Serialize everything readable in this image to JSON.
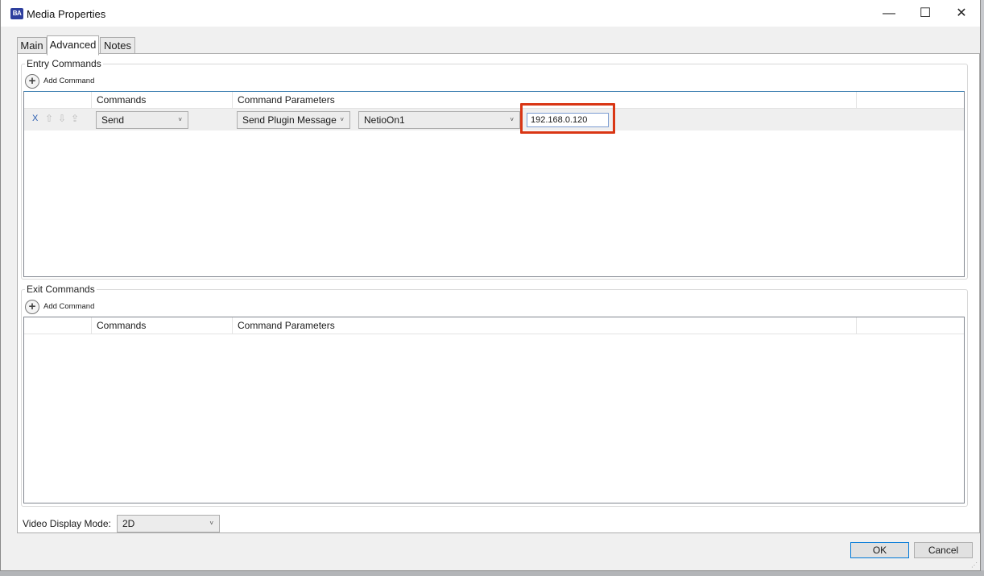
{
  "window": {
    "title": "Media Properties",
    "controls": {
      "minimize": "—",
      "maximize": "☐",
      "close": "✕"
    }
  },
  "tabs": [
    {
      "label": "Main"
    },
    {
      "label": "Advanced"
    },
    {
      "label": "Notes"
    }
  ],
  "entry_commands": {
    "legend": "Entry Commands",
    "add_label": "Add Command",
    "columns": {
      "commands": "Commands",
      "parameters": "Command Parameters"
    },
    "rows": [
      {
        "delete_label": "X",
        "command": "Send",
        "param_type": "Send Plugin Message",
        "plugin": "NetioOn1",
        "value": "192.168.0.120"
      }
    ]
  },
  "exit_commands": {
    "legend": "Exit Commands",
    "add_label": "Add Command",
    "columns": {
      "commands": "Commands",
      "parameters": "Command Parameters"
    }
  },
  "video_display": {
    "label": "Video Display Mode:",
    "value": "2D"
  },
  "buttons": {
    "ok": "OK",
    "cancel": "Cancel"
  },
  "colors": {
    "highlight": "#d93614",
    "accent": "#0078d7"
  }
}
